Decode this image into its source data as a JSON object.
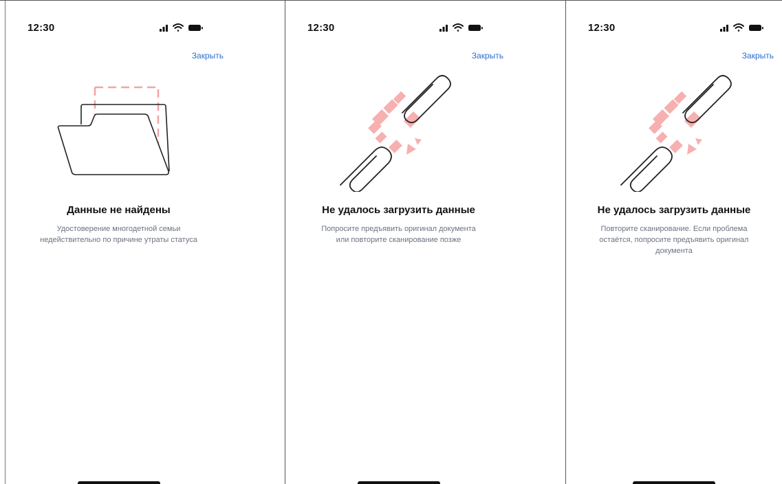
{
  "screens": [
    {
      "status_time": "12:30",
      "close_label": "Закрыть",
      "title": "Данные не найдены",
      "description_lines": [
        "Удостоверение многодетной семьи",
        "недействительно по причине утраты статуса"
      ],
      "illustration": "folder-icon"
    },
    {
      "status_time": "12:30",
      "close_label": "Закрыть",
      "title": "Не удалось загрузить данные",
      "description_lines": [
        "Попросите предъявить оригинал документа",
        "или повторите сканирование позже"
      ],
      "illustration": "broken-link-icon"
    },
    {
      "status_time": "12:30",
      "close_label": "Закрыть",
      "title": "Не удалось загрузить данные",
      "description_lines": [
        "Повторите сканирование. Если проблема",
        "остаётся, попросите предъявить оригинал",
        "документа"
      ],
      "illustration": "broken-link-icon"
    }
  ],
  "colors": {
    "accent": "#2c6fd1",
    "illustration_pink": "#f5a3a3",
    "text_primary": "#111111",
    "text_secondary": "#6b7280"
  }
}
